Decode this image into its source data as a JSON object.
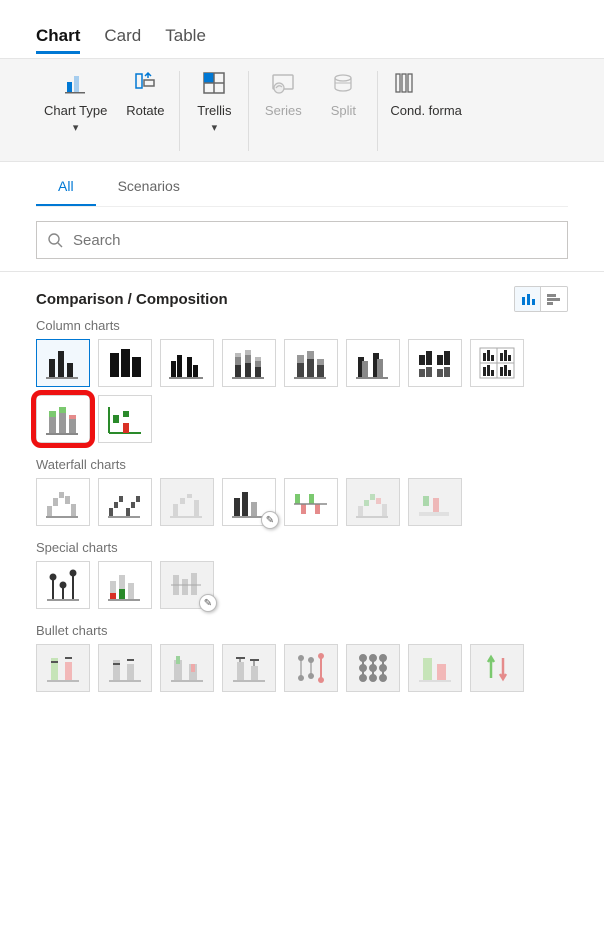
{
  "topTabs": {
    "chart": "Chart",
    "card": "Card",
    "table": "Table"
  },
  "ribbon": {
    "chartType": "Chart Type",
    "rotate": "Rotate",
    "trellis": "Trellis",
    "series": "Series",
    "split": "Split",
    "cond": "Cond. forma"
  },
  "subTabs": {
    "all": "All",
    "scenarios": "Scenarios"
  },
  "search": {
    "placeholder": "Search"
  },
  "category": {
    "title": "Comparison / Composition"
  },
  "groups": {
    "column": "Column charts",
    "waterfall": "Waterfall charts",
    "special": "Special charts",
    "bullet": "Bullet charts"
  }
}
